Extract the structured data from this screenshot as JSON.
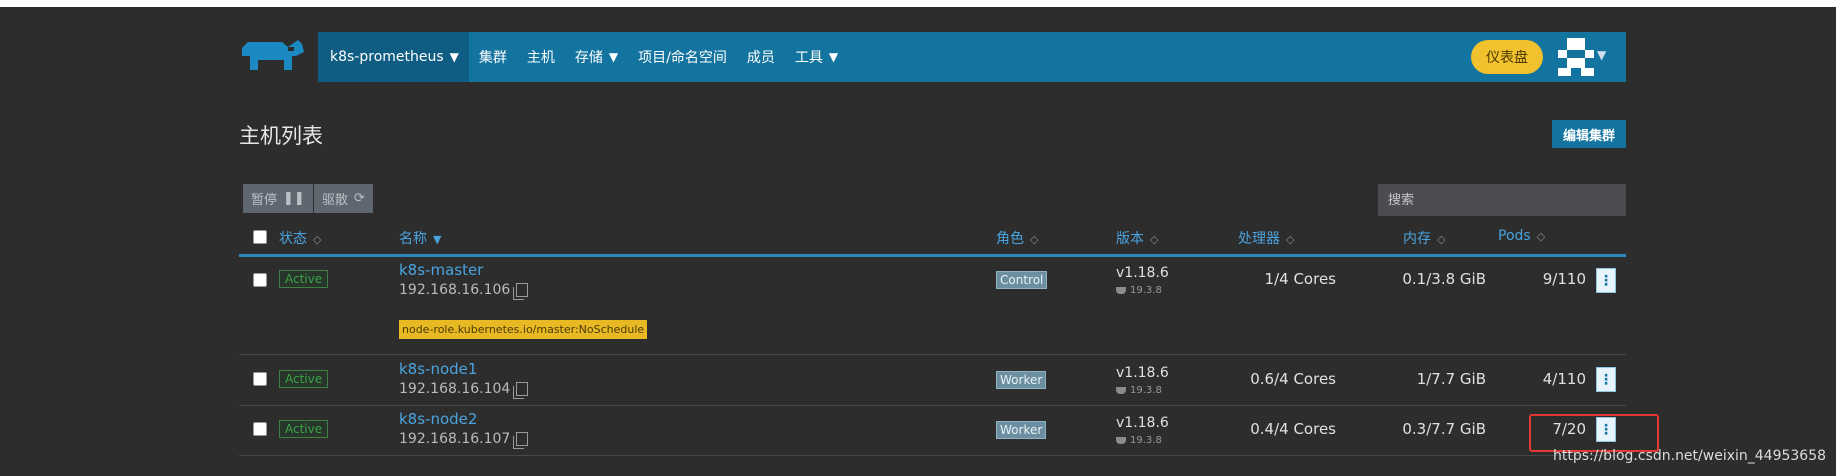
{
  "header": {
    "cluster_name": "k8s-prometheus",
    "nav": [
      "集群",
      "主机",
      "存储",
      "项目/命名空间",
      "成员",
      "工具"
    ],
    "dashboard_label": "仪表盘"
  },
  "page": {
    "title": "主机列表",
    "edit_cluster_label": "编辑集群",
    "pause_label": "暂停",
    "drain_label": "驱散",
    "search_placeholder": "搜索"
  },
  "table": {
    "columns": [
      "状态",
      "名称",
      "角色",
      "版本",
      "处理器",
      "内存",
      "Pods"
    ],
    "rows": [
      {
        "status": "Active",
        "name": "k8s-master",
        "ip": "192.168.16.106",
        "taint": "node-role.kubernetes.io/master:NoSchedule",
        "role": "Control",
        "version": "v1.18.6",
        "docker": "19.3.8",
        "cpu": "1/4 Cores",
        "memory": "0.1/3.8 GiB",
        "pods": "9/110"
      },
      {
        "status": "Active",
        "name": "k8s-node1",
        "ip": "192.168.16.104",
        "taint": "",
        "role": "Worker",
        "version": "v1.18.6",
        "docker": "19.3.8",
        "cpu": "0.6/4 Cores",
        "memory": "1/7.7 GiB",
        "pods": "4/110"
      },
      {
        "status": "Active",
        "name": "k8s-node2",
        "ip": "192.168.16.107",
        "taint": "",
        "role": "Worker",
        "version": "v1.18.6",
        "docker": "19.3.8",
        "cpu": "0.4/4 Cores",
        "memory": "0.3/7.7 GiB",
        "pods": "7/20"
      }
    ]
  },
  "watermark": "https://blog.csdn.net/weixin_44953658",
  "colors": {
    "brand": "#1474a0",
    "brand_dark": "#0f5d83",
    "dashboard": "#f2c12e",
    "background": "#2d2d2d",
    "link": "#4aa3df",
    "highlight": "#e53935"
  }
}
